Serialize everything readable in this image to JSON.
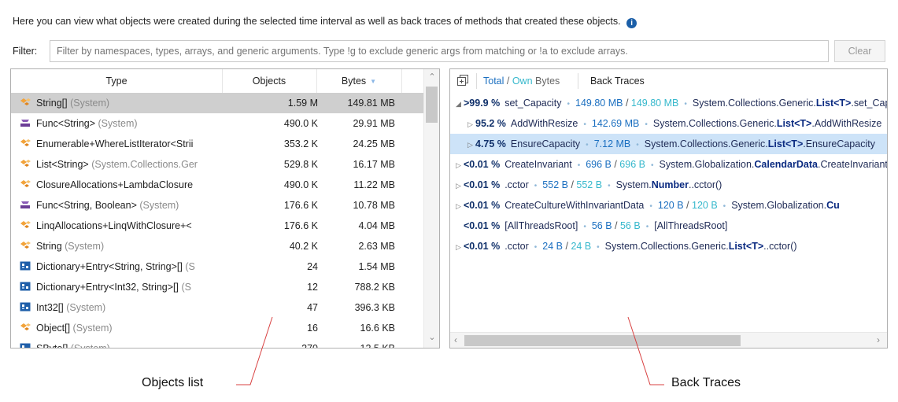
{
  "description": "Here you can view what objects were created during the selected time interval as well as back traces of methods that created these objects.",
  "info_icon": "info-icon",
  "filter": {
    "label": "Filter:",
    "placeholder": "Filter by namespaces, types, arrays, and generic arguments. Type !g to exclude generic args from matching or !a to exclude arrays.",
    "value": "",
    "clear_label": "Clear"
  },
  "objects_table": {
    "columns": {
      "type": "Type",
      "objects": "Objects",
      "bytes": "Bytes"
    },
    "sort_column": "Bytes",
    "sort_direction": "descending",
    "rows": [
      {
        "name": "String[]",
        "ns": " (System)",
        "objects": "1.59 M",
        "bytes": "149.81 MB",
        "icon": "class-icon",
        "selected": true
      },
      {
        "name": "Func<String>",
        "ns": " (System)",
        "objects": "490.0 K",
        "bytes": "29.91 MB",
        "icon": "delegate-icon"
      },
      {
        "name": "Enumerable+WhereListIterator<Strii",
        "ns": "",
        "objects": "353.2 K",
        "bytes": "24.25 MB",
        "icon": "class-icon"
      },
      {
        "name": "List<String>",
        "ns": " (System.Collections.Ger",
        "objects": "529.8 K",
        "bytes": "16.17 MB",
        "icon": "class-icon"
      },
      {
        "name": "ClosureAllocations+LambdaClosure",
        "ns": "",
        "objects": "490.0 K",
        "bytes": "11.22 MB",
        "icon": "class-icon"
      },
      {
        "name": "Func<String, Boolean>",
        "ns": " (System)",
        "objects": "176.6 K",
        "bytes": "10.78 MB",
        "icon": "delegate-icon"
      },
      {
        "name": "LinqAllocations+LinqWithClosure+<",
        "ns": "",
        "objects": "176.6 K",
        "bytes": "4.04 MB",
        "icon": "class-icon"
      },
      {
        "name": "String",
        "ns": " (System)",
        "objects": "40.2 K",
        "bytes": "2.63 MB",
        "icon": "class-icon"
      },
      {
        "name": "Dictionary+Entry<String, String>[]",
        "ns": " (S",
        "objects": "24",
        "bytes": "1.54 MB",
        "icon": "struct-icon"
      },
      {
        "name": "Dictionary+Entry<Int32, String>[]",
        "ns": " (S",
        "objects": "12",
        "bytes": "788.2 KB",
        "icon": "struct-icon"
      },
      {
        "name": "Int32[]",
        "ns": " (System)",
        "objects": "47",
        "bytes": "396.3 KB",
        "icon": "struct-icon"
      },
      {
        "name": "Object[]",
        "ns": " (System)",
        "objects": "16",
        "bytes": "16.6 KB",
        "icon": "class-icon"
      },
      {
        "name": "SByte[]",
        "ns": " (System)",
        "objects": "270",
        "bytes": "12.5 KB",
        "icon": "struct-icon"
      }
    ]
  },
  "back_traces": {
    "toolbar": {
      "total": "Total",
      "sep": " / ",
      "own": "Own",
      "bytes": " Bytes",
      "tab": "Back Traces"
    },
    "rows": [
      {
        "level": 0,
        "expander": "expanded",
        "pct": ">99.9 %",
        "method": "set_Capacity",
        "total": "149.80 MB",
        "own": "149.80 MB",
        "cls_pre": "System.Collections.Generic.",
        "cls_bold": "List<T>",
        "cls_post": ".set_Capacity"
      },
      {
        "level": 1,
        "expander": "collapsed",
        "pct": "95.2 %",
        "method": "AddWithResize",
        "total": "142.69 MB",
        "own": "",
        "cls_pre": "System.Collections.Generic.",
        "cls_bold": "List<T>",
        "cls_post": ".AddWithResize"
      },
      {
        "level": 1,
        "expander": "collapsed",
        "pct": "4.75 %",
        "method": "EnsureCapacity",
        "total": "7.12 MB",
        "own": "",
        "cls_pre": "System.Collections.Generic.",
        "cls_bold": "List<T>",
        "cls_post": ".EnsureCapacity",
        "selected": true
      },
      {
        "level": 0,
        "expander": "collapsed",
        "pct": "<0.01 %",
        "method": "CreateInvariant",
        "total": "696 B",
        "own": "696 B",
        "cls_pre": "System.Globalization.",
        "cls_bold": "CalendarData",
        "cls_post": ".CreateInvariant"
      },
      {
        "level": 0,
        "expander": "collapsed",
        "pct": "<0.01 %",
        "method": ".cctor",
        "total": "552 B",
        "own": "552 B",
        "cls_pre": "System.",
        "cls_bold": "Number",
        "cls_post": "..cctor()"
      },
      {
        "level": 0,
        "expander": "collapsed",
        "pct": "<0.01 %",
        "method": "CreateCultureWithInvariantData",
        "total": "120 B",
        "own": "120 B",
        "cls_pre": "System.Globalization.",
        "cls_bold": "Cu",
        "cls_post": ""
      },
      {
        "level": 0,
        "expander": "none",
        "pct": "<0.01 %",
        "method": "[AllThreadsRoot]",
        "total": "56 B",
        "own": "56 B",
        "cls_pre": "[AllThreadsRoot]",
        "cls_bold": "",
        "cls_post": ""
      },
      {
        "level": 0,
        "expander": "collapsed",
        "pct": "<0.01 %",
        "method": ".cctor",
        "total": "24 B",
        "own": "24 B",
        "cls_pre": "System.Collections.Generic.",
        "cls_bold": "List<T>",
        "cls_post": "..cctor()"
      }
    ]
  },
  "annotations": {
    "objects_list": "Objects list",
    "back_traces": "Back Traces"
  },
  "colors": {
    "total": "#1b6fc0",
    "own": "#36b8cc",
    "selection_left": "#cfcfcf",
    "selection_right": "#cde3f8"
  }
}
